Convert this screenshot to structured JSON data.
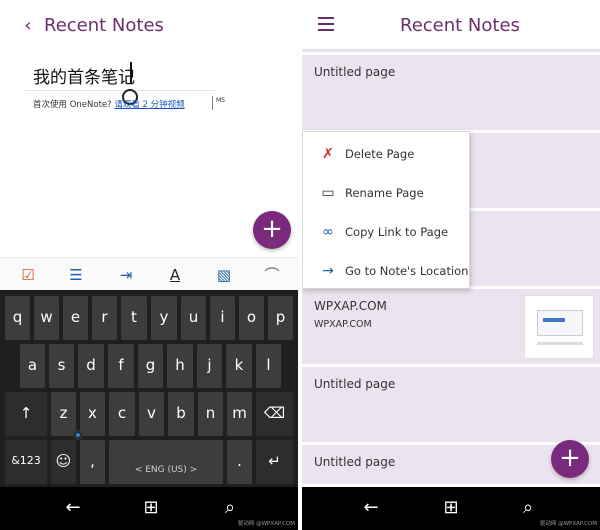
{
  "left": {
    "header": {
      "title": "Recent Notes"
    },
    "note": {
      "title": "我的首条笔记",
      "body_prefix": "首次使用 OneNote? ",
      "body_link": "请观看 2 分钟视频",
      "margin_mark": "MS"
    },
    "toolbar": {
      "items": [
        "checkbox-icon",
        "list-icon",
        "indent-icon",
        "font-color-icon",
        "image-icon",
        "attach-icon"
      ]
    },
    "keyboard": {
      "row1": [
        "q",
        "w",
        "e",
        "r",
        "t",
        "y",
        "u",
        "i",
        "o",
        "p"
      ],
      "row2": [
        "a",
        "s",
        "d",
        "f",
        "g",
        "h",
        "j",
        "k",
        "l"
      ],
      "row3": [
        "z",
        "x",
        "c",
        "v",
        "b",
        "n",
        "m"
      ],
      "numbers_key": "&123",
      "space_label": "< ENG (US) >",
      "comma": ",",
      "period": "."
    },
    "navbar": {
      "watermark": "驱动网 @WPXAP.COM"
    }
  },
  "right": {
    "header": {
      "title": "Recent Notes"
    },
    "notes": [
      {
        "title": "Untitled page"
      },
      {
        "title": "WPXAP.COM",
        "subtitle": "WPXAP.COM"
      },
      {
        "title": "Untitled page"
      },
      {
        "title": "Untitled page"
      }
    ],
    "context_menu": [
      {
        "label": "Delete Page",
        "icon": "delete-page-icon"
      },
      {
        "label": "Rename Page",
        "icon": "rename-page-icon"
      },
      {
        "label": "Copy Link to Page",
        "icon": "copy-link-icon"
      },
      {
        "label": "Go to Note's Location",
        "icon": "go-to-location-icon"
      }
    ],
    "navbar": {
      "watermark": "驱动网 @WPXAP.COM"
    }
  },
  "colors": {
    "accent": "#7a2a7d",
    "header_text": "#6a2f6e",
    "note_background": "#ebe3ef",
    "keyboard_background": "#1f1f1f",
    "key": "#3d3d3d"
  }
}
